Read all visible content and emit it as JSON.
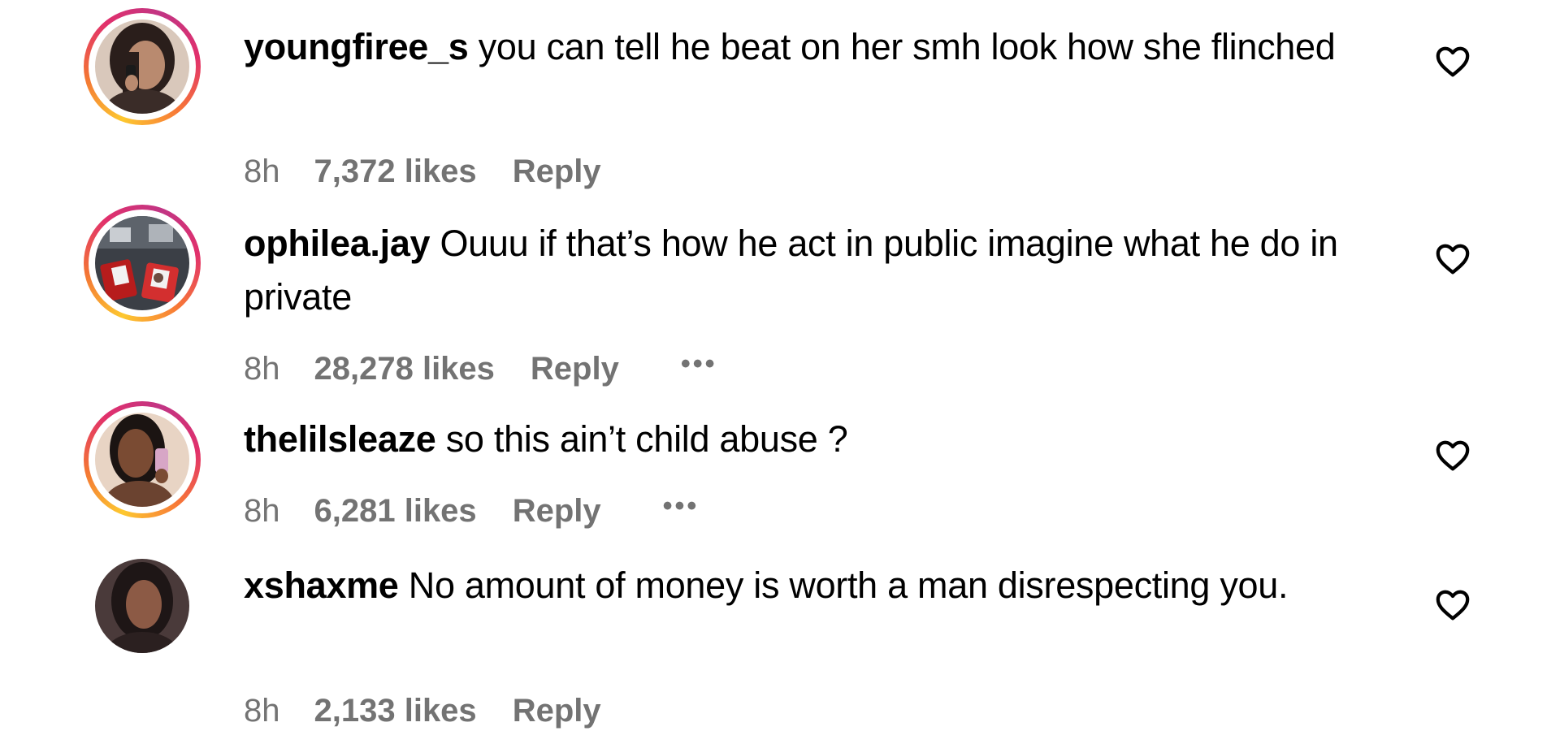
{
  "comments": [
    {
      "username": "youngfiree_s",
      "text": "you can tell he beat on her smh look how she flinched",
      "time": "8h",
      "likes": "7,372 likes",
      "reply": "Reply",
      "has_story_ring": true,
      "show_more": false,
      "more_icon": ""
    },
    {
      "username": "ophilea.jay",
      "text": "Ouuu if that’s how he act in public imagine what he do in private",
      "time": "8h",
      "likes": "28,278 likes",
      "reply": "Reply",
      "has_story_ring": true,
      "show_more": true,
      "more_icon": "•••"
    },
    {
      "username": "thelilsleaze",
      "text": "so this ain’t child abuse ?",
      "time": "8h",
      "likes": "6,281 likes",
      "reply": "Reply",
      "has_story_ring": true,
      "show_more": true,
      "more_icon": "•••"
    },
    {
      "username": "xshaxme",
      "text": "No amount of money is worth a man disrespecting you.",
      "time": "8h",
      "likes": "2,133 likes",
      "reply": "Reply",
      "has_story_ring": false,
      "show_more": false,
      "more_icon": ""
    }
  ],
  "icons": {
    "like": "heart-outline-icon",
    "more": "more-options-icon"
  },
  "colors": {
    "text": "#000000",
    "meta": "#737373",
    "story_ring": [
      "#fdc830",
      "#f37335",
      "#e1306c",
      "#c13584"
    ]
  }
}
